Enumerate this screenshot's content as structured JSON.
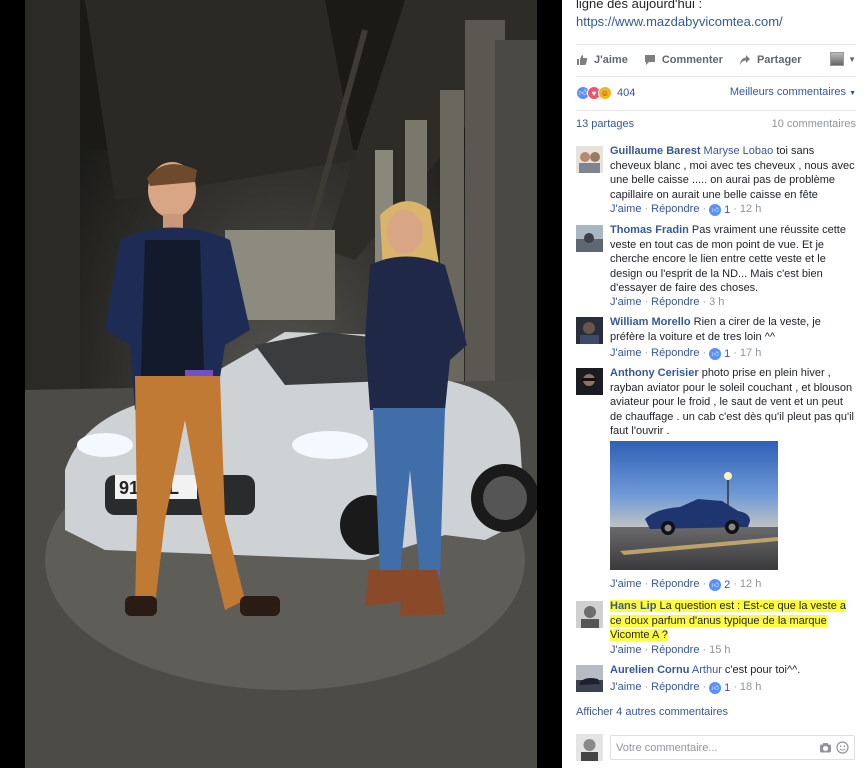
{
  "post": {
    "text_line": "ligne dès aujourd'hui :",
    "link": "https://www.mazdabyvicomtea.com/"
  },
  "photo": {
    "plate_text": "912-BL"
  },
  "actions": {
    "like": "J'aime",
    "comment": "Commenter",
    "share": "Partager",
    "like_icon": "thumbs-up-icon",
    "comment_icon": "speech-bubble-icon",
    "share_icon": "share-arrow-icon"
  },
  "reactions": {
    "count": "404",
    "sort_label": "Meilleurs commentaires",
    "types": [
      "like",
      "love",
      "haha"
    ]
  },
  "stats": {
    "shares": "13 partages",
    "comments": "10 commentaires"
  },
  "comments": [
    {
      "name": "Guillaume Barest",
      "tag": "Maryse Lobao",
      "text": " toi sans cheveux blanc , moi avec tes cheveux , nous avec une belle caisse ..... on aurai pas de problème capillaire on aurait une belle caisse en fête",
      "like": "J'aime",
      "reply": "Répondre",
      "likes": "1",
      "time": "12 h"
    },
    {
      "name": "Thomas Fradin",
      "tag": "",
      "text": " Pas vraiment une réussite cette veste en tout cas de mon point de vue. Et je cherche encore le lien entre cette veste et le design ou l'esprit de la ND... Mais c'est bien d'essayer de faire des choses.",
      "like": "J'aime",
      "reply": "Répondre",
      "likes": "",
      "time": "3 h"
    },
    {
      "name": "William Morello",
      "tag": "",
      "text": " Rien a cirer de la veste, je préfère la voiture et de tres loin ^^",
      "like": "J'aime",
      "reply": "Répondre",
      "likes": "1",
      "time": "17 h"
    },
    {
      "name": "Anthony Cerisier",
      "tag": "",
      "text": " photo prise en plein hiver , rayban aviator pour le soleil couchant , et blouson aviateur pour le froid , le saut de vent et un peut de chauffage . un cab c'est dès qu'il pleut pas qu'il faut l'ouvrir .",
      "like": "J'aime",
      "reply": "Répondre",
      "likes": "2",
      "time": "12 h"
    },
    {
      "name": "Hans Lip",
      "tag": "",
      "text": " La question est : Est-ce que la veste a ce doux parfum d'anus typique de la marque Vicomte A ?",
      "like": "J'aime",
      "reply": "Répondre",
      "likes": "",
      "time": "15 h"
    },
    {
      "name": "Aurelien Cornu",
      "tag": "Arthur",
      "text": " c'est pour toi^^.",
      "like": "J'aime",
      "reply": "Répondre",
      "likes": "1",
      "time": "18 h"
    }
  ],
  "more_comments": "Afficher 4 autres commentaires",
  "composer": {
    "placeholder": "Votre commentaire...",
    "camera_icon": "camera-icon",
    "emoji_icon": "emoji-icon"
  },
  "colors": {
    "link": "#365899",
    "highlight": "#fffc3f",
    "meta": "#90949c"
  }
}
